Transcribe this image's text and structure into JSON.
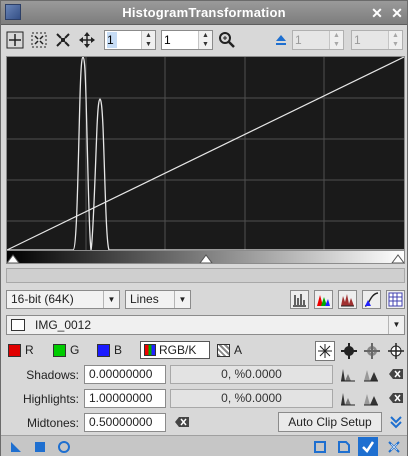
{
  "window": {
    "title": "HistogramTransformation"
  },
  "toolbar": {
    "zoom_h": "1",
    "zoom_v": "1",
    "disabled_a": "1",
    "disabled_b": "1"
  },
  "mode": {
    "bit_depth": "16-bit (64K)",
    "graph_style": "Lines"
  },
  "image": {
    "selected": "IMG_0012"
  },
  "channels": {
    "r": "R",
    "g": "G",
    "b": "B",
    "rgbk": "RGB/K",
    "a": "A"
  },
  "fields": {
    "shadows_label": "Shadows:",
    "shadows_value": "0.00000000",
    "shadows_clip": "0, %0.0000",
    "highlights_label": "Highlights:",
    "highlights_value": "1.00000000",
    "highlights_clip": "0, %0.0000",
    "midtones_label": "Midtones:",
    "midtones_value": "0.50000000"
  },
  "buttons": {
    "auto_clip_setup": "Auto Clip Setup"
  },
  "colors": {
    "red": "#e00000",
    "green": "#00cc00",
    "blue": "#1a1aff",
    "accent": "#1e6fd0"
  }
}
